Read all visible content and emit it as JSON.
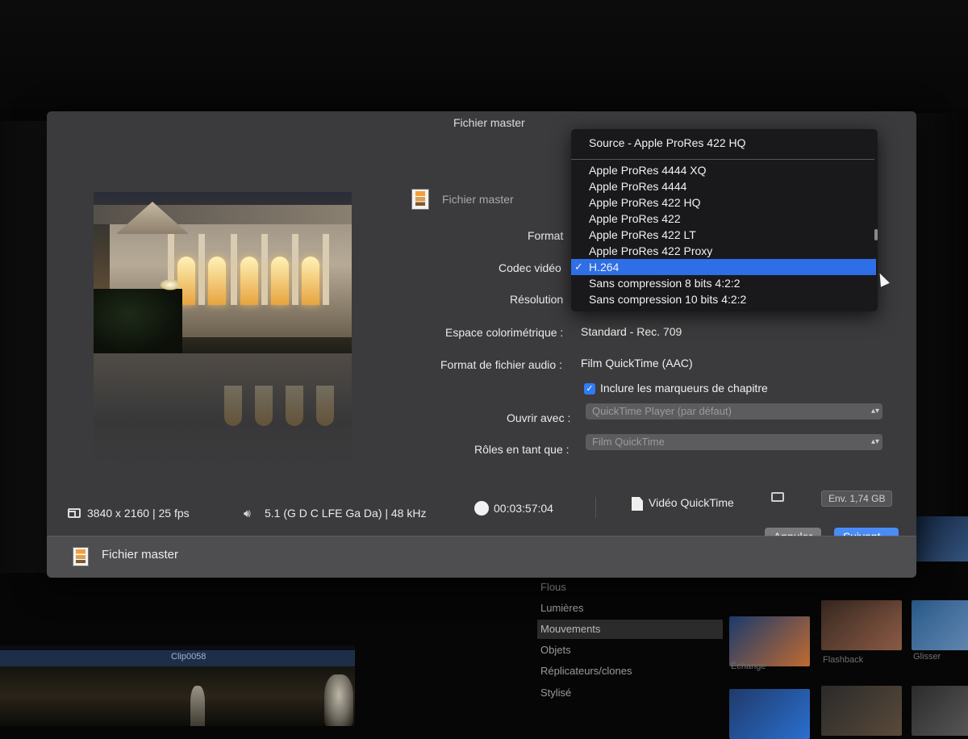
{
  "dialog": {
    "title": "Fichier master",
    "master_label": "Fichier master",
    "labels": {
      "format": "Format",
      "codec": "Codec vidéo",
      "resolution": "Résolution",
      "colorspace": "Espace colorimétrique :",
      "audio_format": "Format de fichier audio :",
      "open_with": "Ouvrir avec :",
      "roles": "Rôles en tant que :"
    },
    "values": {
      "colorspace": "Standard - Rec. 709",
      "audio_format": "Film QuickTime (AAC)"
    },
    "chapter_markers": {
      "checked": true,
      "label": "Inclure les marqueurs de chapitre"
    },
    "open_with_select": "QuickTime Player (par défaut)",
    "roles_select": "Film QuickTime",
    "footer": {
      "resolution": "3840 x 2160 | 25 fps",
      "audio": "5.1 (G D C LFE Ga Da) | 48 kHz",
      "duration": "00:03:57:04",
      "file_type": "Vidéo QuickTime",
      "size": "Env. 1,74 GB"
    },
    "bottom_bar_label": "Fichier master",
    "buttons": {
      "cancel": "Annuler",
      "next": "Suivant..."
    }
  },
  "codec_menu": {
    "source": "Source - Apple ProRes 422 HQ",
    "items": [
      "Apple ProRes 4444 XQ",
      "Apple ProRes 4444",
      "Apple ProRes 422 HQ",
      "Apple ProRes 422",
      "Apple ProRes 422 LT",
      "Apple ProRes 422 Proxy",
      "H.264",
      "Sans compression 8 bits 4:2:2",
      "Sans compression 10 bits 4:2:2"
    ],
    "selected": "H.264",
    "check": "✓"
  },
  "background": {
    "effects": [
      "Flous",
      "Lumières",
      "Mouvements",
      "Objets",
      "Réplicateurs/clones",
      "Stylisé"
    ],
    "selected_effect": "Mouvements",
    "thumb_labels": [
      "Échange",
      "Flashback",
      "Glisser"
    ],
    "clip_name": "Clip0058"
  },
  "colors": {
    "accent": "#2e6ee6",
    "primary_button": "#4a8cf5",
    "dialog_bg": "#3b3b3d"
  }
}
